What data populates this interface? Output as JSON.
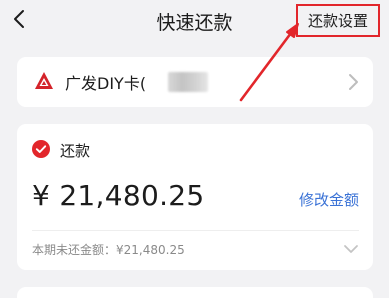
{
  "header": {
    "title": "快速还款",
    "back_icon": "chevron-left-icon",
    "settings_label": "还款设置",
    "highlight_color": "#e2262b"
  },
  "card_select": {
    "bank_icon": "guangfa-bank-logo-icon",
    "card_name": "广发DIY卡(",
    "chevron_icon": "chevron-right-icon"
  },
  "repay": {
    "check_icon": "checked-circle-icon",
    "label": "还款",
    "amount": "¥ 21,480.25",
    "modify_label": "修改金额",
    "unpaid_info": "本期未还金额：¥21,480.25",
    "expand_icon": "chevron-down-icon"
  },
  "colors": {
    "accent_red": "#e2262b",
    "link_blue": "#3a72d6",
    "background": "#f2f2f4"
  }
}
